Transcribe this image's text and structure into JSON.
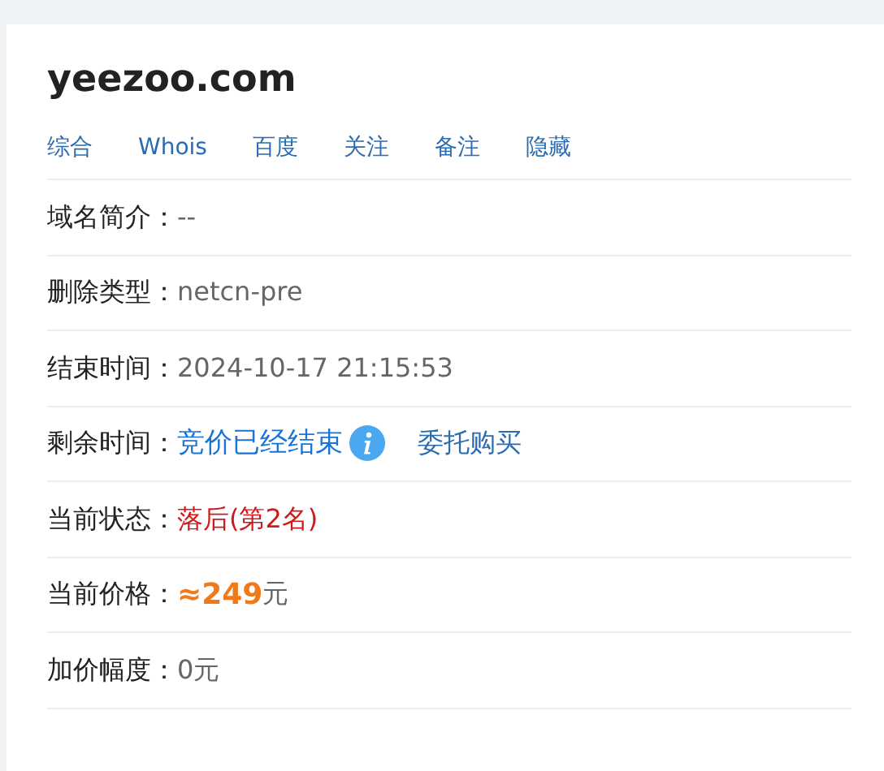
{
  "title": "yeezoo.com",
  "links": [
    "综合",
    "Whois",
    "百度",
    "关注",
    "备注",
    "隐藏"
  ],
  "rows": [
    {
      "kind": "text",
      "label": "域名简介：",
      "value": "--"
    },
    {
      "kind": "text",
      "label": "删除类型：",
      "value": "netcn-pre"
    },
    {
      "kind": "text",
      "label": "结束时间：",
      "value": "2024-10-17 21:15:53"
    },
    {
      "kind": "link",
      "label": "剩余时间：",
      "value": "竞价已经结束",
      "action": "委托购买"
    },
    {
      "kind": "status",
      "label": "当前状态：",
      "value": "落后(第2名)"
    },
    {
      "kind": "price",
      "label": "当前价格：",
      "value": "≈249",
      "unit": "元"
    },
    {
      "kind": "text",
      "label": "加价幅度：",
      "value": "0元"
    }
  ]
}
